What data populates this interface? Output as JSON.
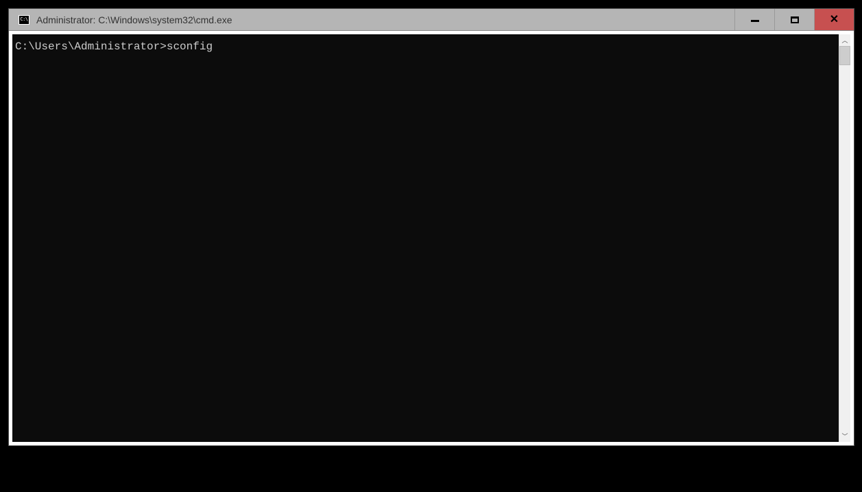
{
  "window": {
    "title": "Administrator: C:\\Windows\\system32\\cmd.exe",
    "icon_label": "C:\\"
  },
  "terminal": {
    "prompt": "C:\\Users\\Administrator>",
    "command": "sconfig"
  }
}
